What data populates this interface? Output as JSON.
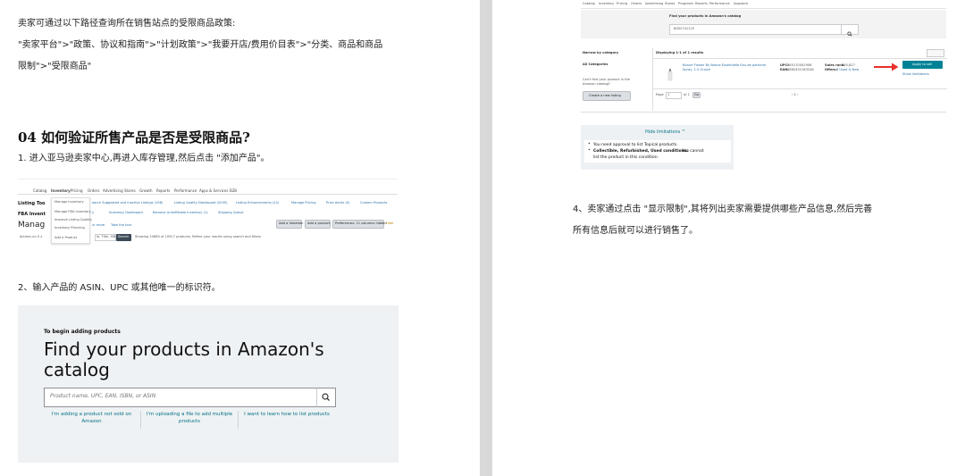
{
  "left_page": {
    "para1": "卖家可通过以下路径查询所在销售站点的受限商品政策:",
    "para2_line1": "\"卖家平台\">\"政策、协议和指南\">\"计划政策\">\"我要开店/费用价目表\">\"分类、商品和商品",
    "para2_line2": "限制\">\"受限商品\"",
    "heading": "04 如何验证所售产品是否是受限商品?",
    "step1": "1. 进入亚马逊卖家中心,再进入库存管理,然后点击 \"添加产品\"。",
    "step2": "2、输入产品的 ASIN、UPC 或其他唯一的标识符。",
    "inventory_shot": {
      "nav": [
        "Catalog",
        "Inventory",
        "Pricing",
        "Orders",
        "Advertising",
        "Stores",
        "Growth",
        "Reports",
        "Performance",
        "Apps & Services",
        "B2B"
      ],
      "dropdown": [
        "Manage Inventory",
        "Manage FBA Inventory",
        "Improve Listing Quality",
        "Inventory Planning",
        "Add a Product"
      ],
      "subnav": [
        "earch Suggested and Inactive Listings (198)",
        "Listing Quality Dashboard (2039)",
        "Listing Enhancements (22)",
        "Manage Pricing",
        "Price Alerts (0)",
        "Custom Products"
      ],
      "row2": [
        "y",
        "Inventory Dashboard",
        "Remove Unfulfillable Inventory (1)",
        "Shipping Queue"
      ],
      "left_labels": [
        "Listing Too",
        "FBA Invent",
        "Manag"
      ],
      "left_small": "Actions on 0 s",
      "row3": [
        "ur more",
        "Take the tour"
      ],
      "search_placeholder": "le, Title, ISB",
      "search_btn": "Search",
      "showing": "Showing 10883 of 10917 products. Refine your results using search and filters",
      "right_btns": [
        "Add a Variation",
        "Add a product",
        "Preferences: 11 columns hidden"
      ],
      "right_more": "Hide"
    },
    "find_shot": {
      "kicker": "To begin adding products",
      "title_line1": "Find your products in Amazon's",
      "title_line2": "catalog",
      "placeholder": "Product name, UPC, EAN, ISBN, or ASIN",
      "search_icon": "magnifier-icon",
      "links": [
        {
          "line1": "I'm adding a product not sold on",
          "line2": "Amazon"
        },
        {
          "line1": "I'm uploading a file to add multiple",
          "line2": "products"
        },
        {
          "line1": "I want to learn how to list products",
          "line2": ""
        }
      ]
    }
  },
  "right_page": {
    "result_shot": {
      "nav": [
        "Catalog",
        "Inventory",
        "Pricing",
        "Orders",
        "Advertising",
        "Stores",
        "Programs",
        "Reports",
        "Performance",
        "Appstore"
      ],
      "find_label": "Find your products in Amazon's catalog",
      "search_value": "B002741125",
      "narrow": "Narrow by category",
      "all_categories": "All Categories",
      "cant_find_1": "Can't find your product in the",
      "cant_find_2": "Amazon catalog?",
      "create_btn": "Create a new listing",
      "displaying": "Displaying 1-1 of 1 results",
      "product_1": "Bonne Flower By Bonne Essentielle Eau de parfume",
      "product_2": "Spray, 1.5 Ounce",
      "upc_label": "UPC:",
      "upc": "885170002908",
      "ean_label": "EAN:",
      "ean": "0885432163246",
      "sales_rank_label": "Sales rank:",
      "sales_rank": "605,827",
      "offers_label": "Offers:",
      "offers": "6 Used & New",
      "apply_btn": "Apply to sell",
      "show_limits": "Show limitations",
      "page_label": "Page",
      "page_value": "1",
      "of_label": "of 1",
      "go": "Go",
      "pager": "‹  1  ›",
      "hide_limits": "Hide limitations ^",
      "limit1": "You need approval to list Topical products.",
      "limit2_bold": "Collectible, Refurbished, Used conditions:",
      "limit2_rest": " You cannot",
      "limit3": "list the product in this condition.",
      "colors": {
        "accent": "#008296",
        "arrow": "#e8312a"
      }
    },
    "step4_line1": "4、卖家通过点击 \"显示限制\",其将列出卖家需要提供哪些产品信息,然后完善",
    "step4_line2": "所有信息后就可以进行销售了。"
  }
}
